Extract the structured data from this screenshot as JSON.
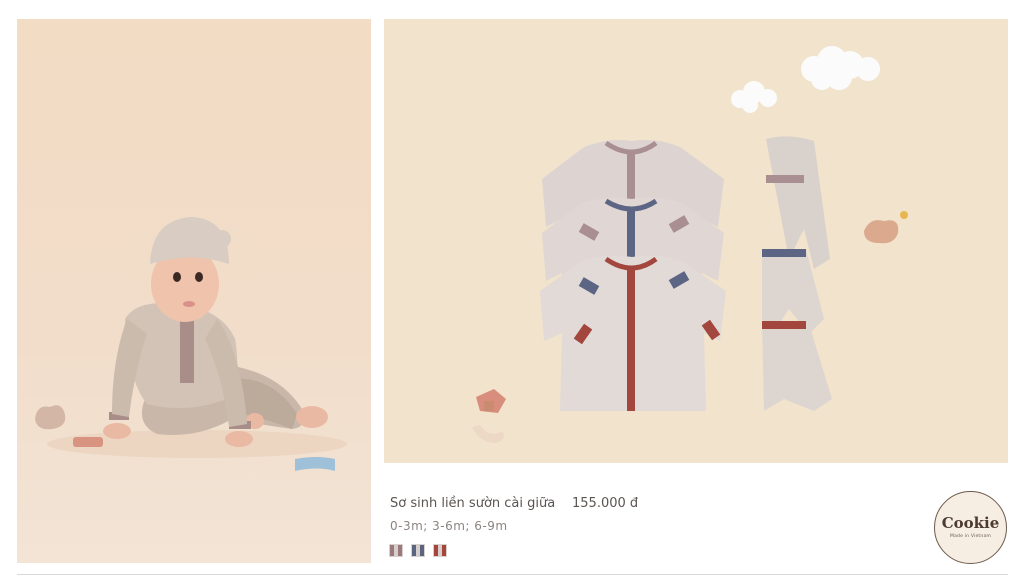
{
  "product": {
    "name": "Sơ sinh liền sườn cài giữa",
    "price": "155.000 đ",
    "sizes": "0-3m;  3-6m;  6-9m",
    "swatches": [
      {
        "name": "mauve",
        "color": "#9b7a7d"
      },
      {
        "name": "navy",
        "color": "#5b6580"
      },
      {
        "name": "red",
        "color": "#a5453b"
      }
    ]
  },
  "brand": {
    "logo_word": "Cookie",
    "logo_tagline": "Made in Vietnam",
    "accent": "#4d3b30"
  },
  "images": {
    "left": "baby-model-photo",
    "right": "product-flatlay-photo"
  }
}
